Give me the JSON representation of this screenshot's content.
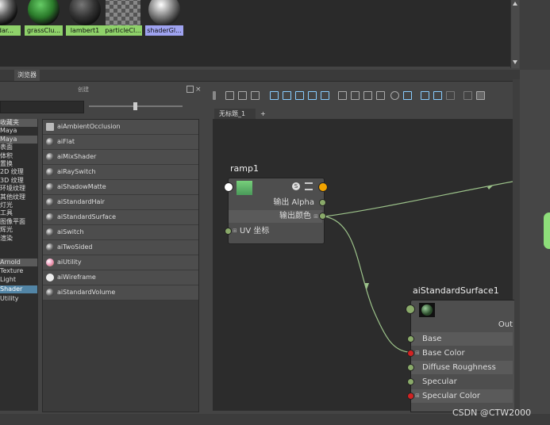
{
  "swatches": [
    {
      "label": "andar..."
    },
    {
      "label": "grassClu..."
    },
    {
      "label": "lambert1"
    },
    {
      "label": "particleCl..."
    },
    {
      "label": "shaderGl..."
    }
  ],
  "tabs": {
    "browser": "浏览器",
    "create": "创建"
  },
  "categories": [
    {
      "label": "收藏夹",
      "kind": "hdr"
    },
    {
      "label": "Maya",
      "kind": ""
    },
    {
      "label": "Maya",
      "kind": "hdr"
    },
    {
      "label": "表面",
      "kind": ""
    },
    {
      "label": "体积",
      "kind": ""
    },
    {
      "label": "置换",
      "kind": ""
    },
    {
      "label": "2D 纹理",
      "kind": ""
    },
    {
      "label": "3D 纹理",
      "kind": ""
    },
    {
      "label": "环境纹理",
      "kind": ""
    },
    {
      "label": "其他纹理",
      "kind": ""
    },
    {
      "label": "灯光",
      "kind": ""
    },
    {
      "label": "工具",
      "kind": ""
    },
    {
      "label": "图像平面",
      "kind": ""
    },
    {
      "label": "辉光",
      "kind": ""
    },
    {
      "label": "渲染",
      "kind": ""
    },
    {
      "label": "Arnold",
      "kind": "hdr"
    },
    {
      "label": "Texture",
      "kind": ""
    },
    {
      "label": "Light",
      "kind": ""
    },
    {
      "label": "Shader",
      "kind": "sel"
    },
    {
      "label": "Utility",
      "kind": ""
    }
  ],
  "nodes_list": [
    {
      "label": "aiAmbientOcclusion",
      "icon": "ao-icon"
    },
    {
      "label": "aiFlat",
      "icon": "sphere-icon"
    },
    {
      "label": "aiMixShader",
      "icon": "sphere-icon"
    },
    {
      "label": "aiRaySwitch",
      "icon": "sphere-icon"
    },
    {
      "label": "aiShadowMatte",
      "icon": "sphere-icon"
    },
    {
      "label": "aiStandardHair",
      "icon": "sphere-icon"
    },
    {
      "label": "aiStandardSurface",
      "icon": "sphere-icon"
    },
    {
      "label": "aiSwitch",
      "icon": "sphere-icon"
    },
    {
      "label": "aiTwoSided",
      "icon": "sphere-icon"
    },
    {
      "label": "aiUtility",
      "icon": "utility-icon"
    },
    {
      "label": "aiWireframe",
      "icon": "wireframe-icon"
    },
    {
      "label": "aiStandardVolume",
      "icon": "sphere-icon"
    }
  ],
  "graph_tabs": {
    "untitled": "无标题_1",
    "add": "+"
  },
  "ramp_node": {
    "title": "ramp1",
    "out_alpha": "输出 Alpha",
    "out_color": "输出颜色",
    "uv": "UV 坐标"
  },
  "surface_node": {
    "title": "aiStandardSurface1",
    "out": "Out",
    "attrs": [
      "Base",
      "Base Color",
      "Diffuse Roughness",
      "Specular",
      "Specular Color"
    ]
  },
  "watermark": "CSDN @CTW2000",
  "colors": {
    "accent_selected": "#5285a6",
    "swatch_label_green": "#8fd26a",
    "swatch_label_blue": "#9fa3f0",
    "connection": "#9cc28a",
    "port_orange": "#f2a400",
    "port_red": "#d22222"
  }
}
